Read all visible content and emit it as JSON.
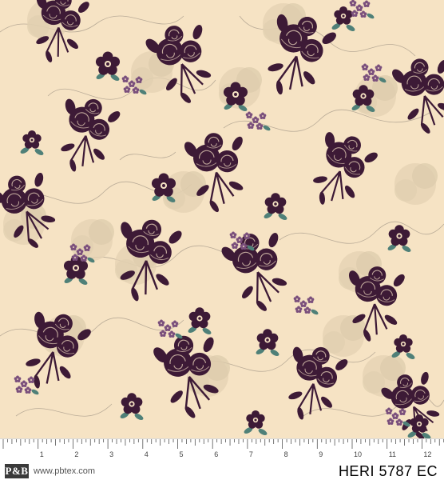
{
  "fabric": {
    "background_color": "#f6e3c4",
    "flower_color": "#3d1a36",
    "small_flower_color": "#7a4f7c",
    "leaf_color": "#4f8078",
    "vine_color": "#b9ab97"
  },
  "ruler": {
    "numbers": [
      "1",
      "2",
      "3",
      "4",
      "5",
      "6",
      "7",
      "8",
      "9",
      "10",
      "11",
      "12"
    ]
  },
  "footer": {
    "logo_text": "P&B",
    "url": "www.pbtex.com",
    "product_code": "HERI 5787 EC"
  }
}
